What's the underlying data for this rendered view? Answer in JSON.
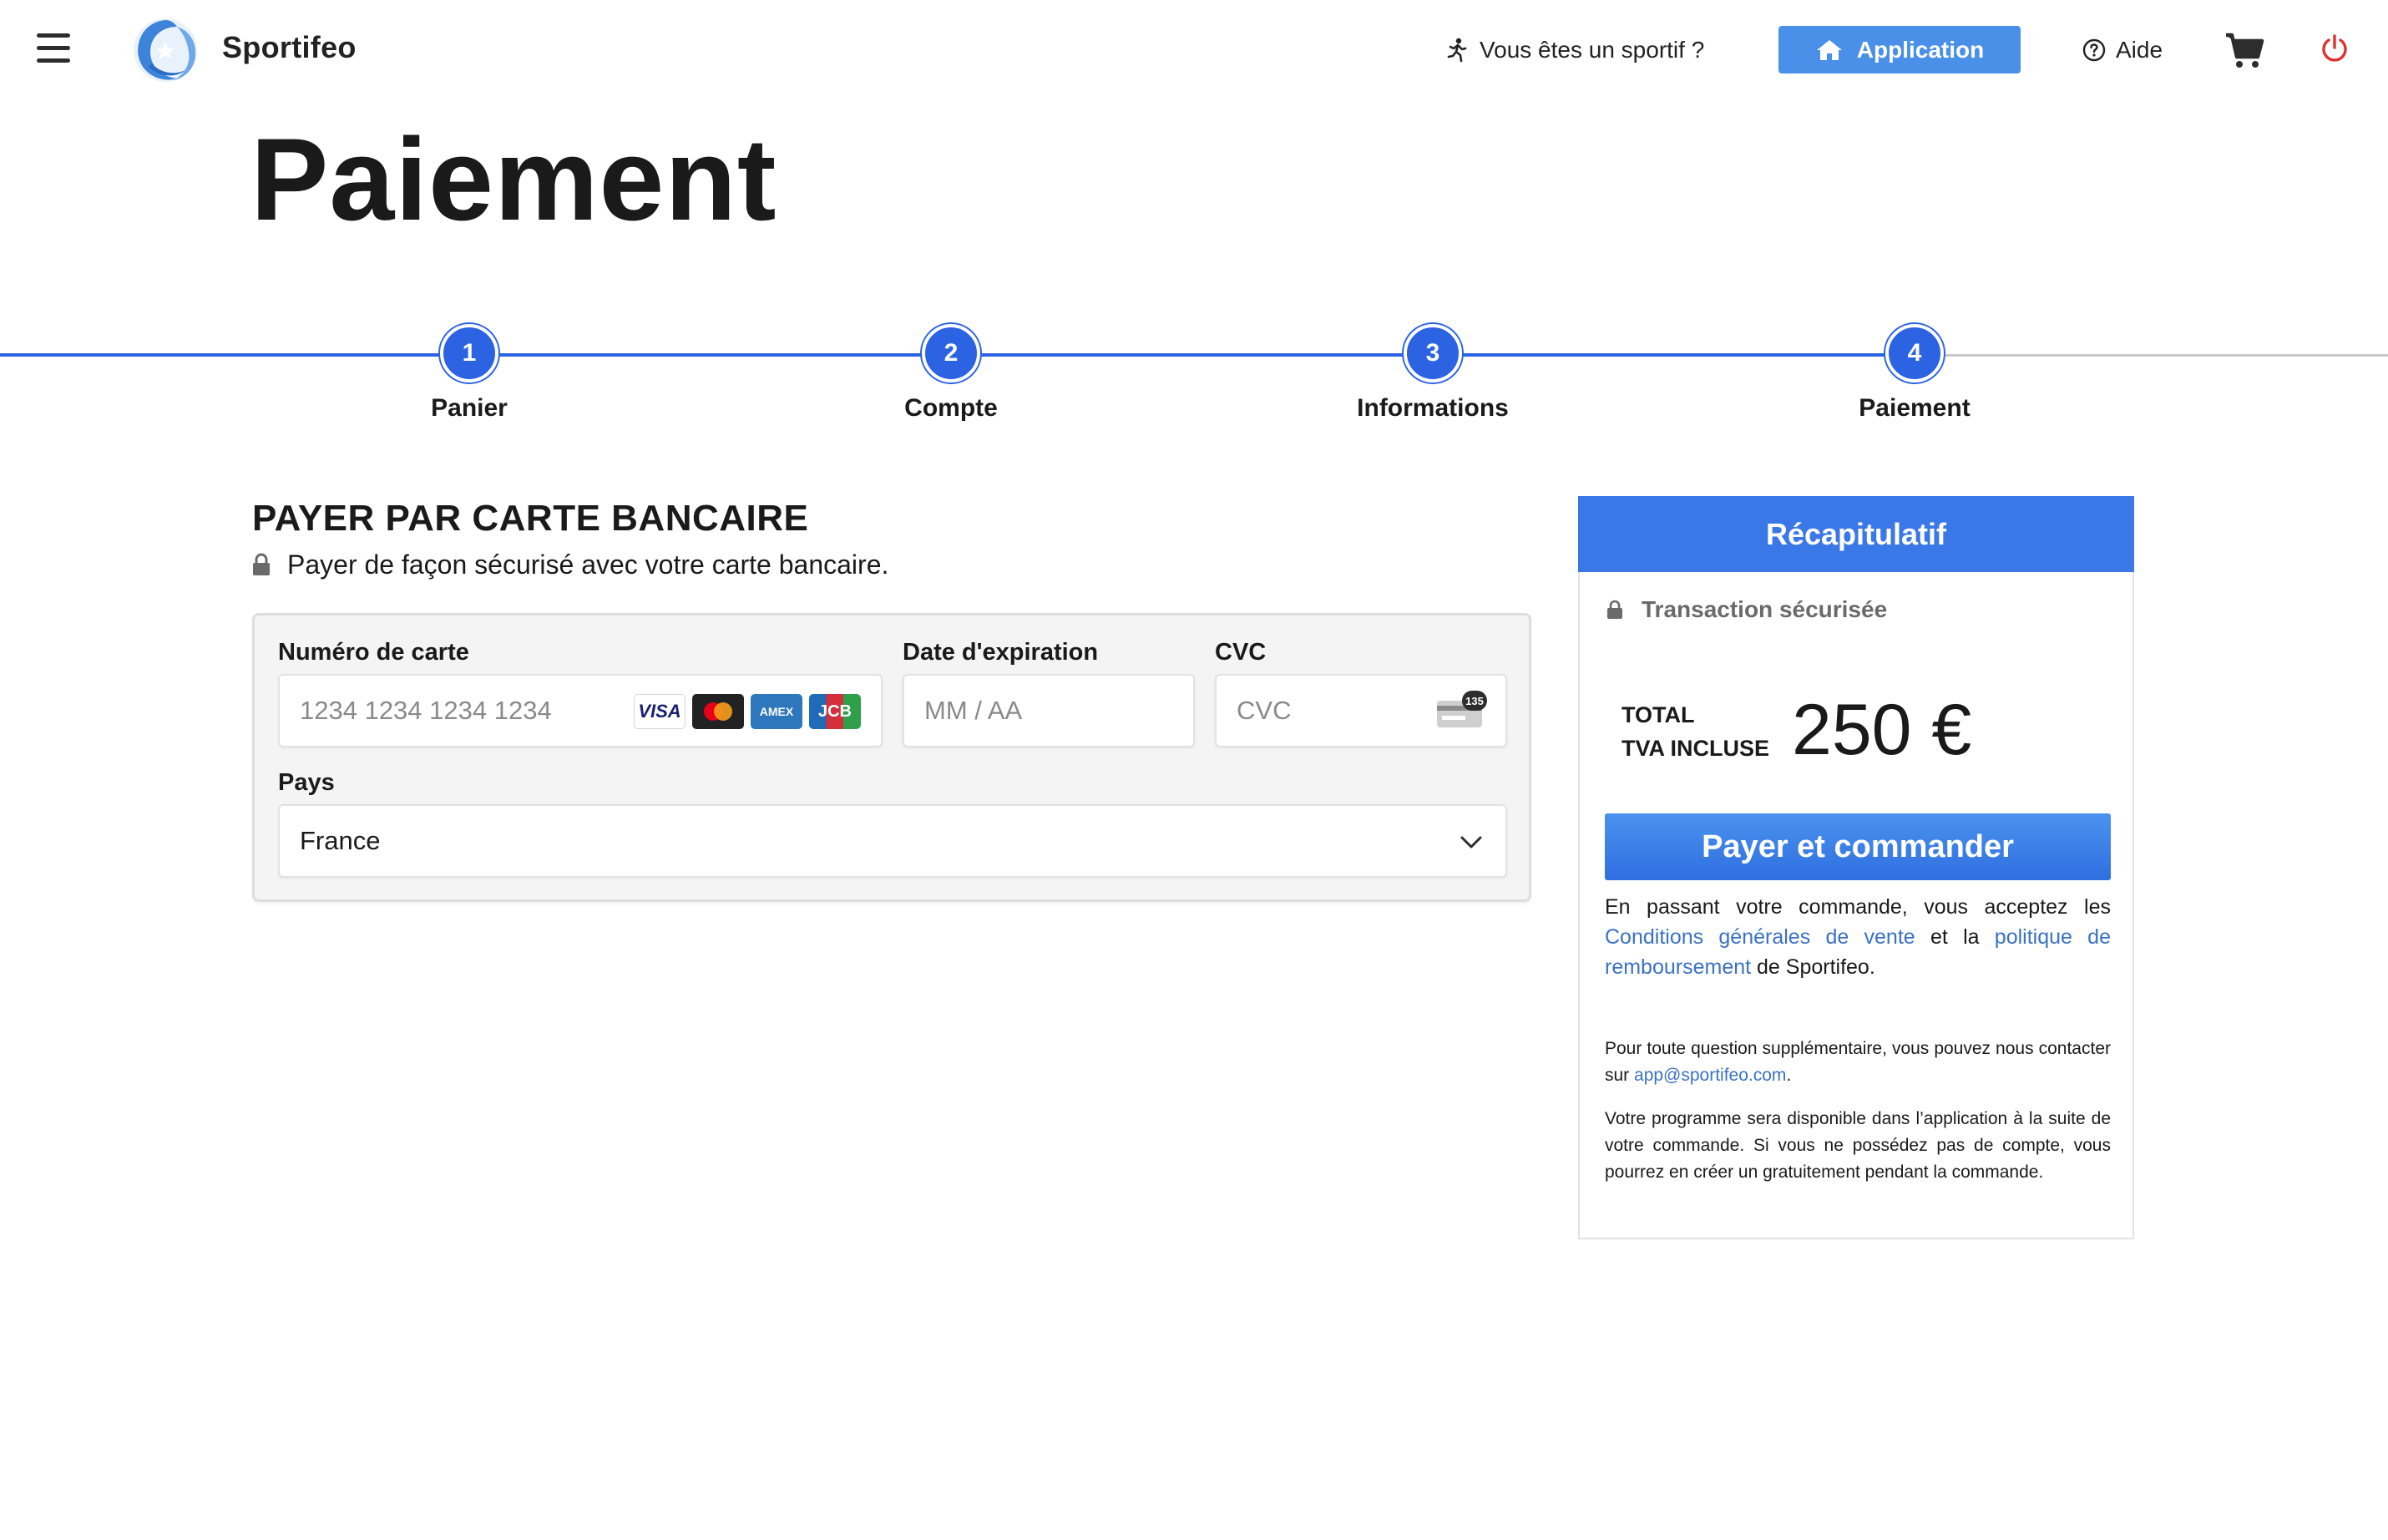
{
  "header": {
    "brand": "Sportifeo",
    "sport_link": "Vous êtes un sportif ?",
    "app_button": "Application",
    "help": "Aide"
  },
  "page": {
    "title": "Paiement"
  },
  "stepper": {
    "steps": [
      {
        "number": "1",
        "label": "Panier"
      },
      {
        "number": "2",
        "label": "Compte"
      },
      {
        "number": "3",
        "label": "Informations"
      },
      {
        "number": "4",
        "label": "Paiement"
      }
    ]
  },
  "payment": {
    "title": "PAYER PAR CARTE BANCAIRE",
    "subtitle": "Payer de façon sécurisé avec votre carte bancaire.",
    "card_number_label": "Numéro de carte",
    "card_number_placeholder": "1234 1234 1234 1234",
    "expiry_label": "Date d'expiration",
    "expiry_placeholder": "MM / AA",
    "cvc_label": "CVC",
    "cvc_placeholder": "CVC",
    "cvc_badge": "135",
    "card_brands": [
      "VISA",
      "AMEX",
      "JCB"
    ],
    "country_label": "Pays",
    "country_value": "France"
  },
  "summary": {
    "title": "Récapitulatif",
    "secure": "Transaction sécurisée",
    "total_line1": "TOTAL",
    "total_line2": "TVA INCLUSE",
    "total_amount": "250 €",
    "pay_button": "Payer et commander",
    "terms_before": "En passant votre commande, vous acceptez les ",
    "terms_link1": "Conditions générales de vente",
    "terms_mid": " et la ",
    "terms_link2": "politique de remboursement",
    "terms_after": " de Sportifeo.",
    "contact_before": "Pour toute question supplémentaire, vous pouvez nous contacter sur ",
    "contact_email": "app@sportifeo.com",
    "contact_after": ".",
    "program_note": "Votre programme sera disponible dans l’application à la suite de votre commande. Si vous ne possédez pas de compte, vous pourrez en créer un gratuitement pendant la commande."
  },
  "colors": {
    "accent": "#2b63e3",
    "header_button": "#4a8fe8",
    "summary_header": "#3b78e7",
    "link": "#3a72c4",
    "power": "#e03030"
  }
}
